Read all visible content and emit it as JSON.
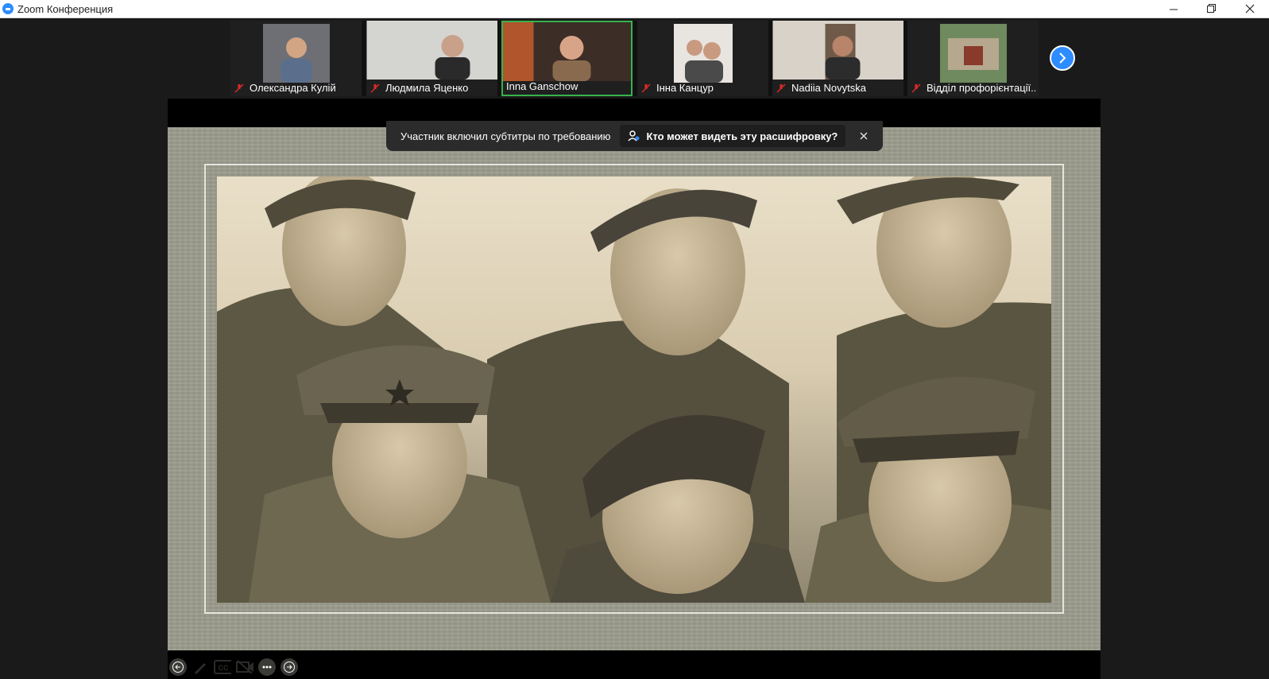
{
  "window": {
    "title": "Zoom Конференция"
  },
  "participants": [
    {
      "name": "Олександра Кулій",
      "muted": true
    },
    {
      "name": "Людмила Яценко",
      "muted": true
    },
    {
      "name": "Inna Ganschow",
      "muted": false,
      "active": true
    },
    {
      "name": "Інна Канцур",
      "muted": true
    },
    {
      "name": "Nadiia Novytska",
      "muted": true
    },
    {
      "name": "Відділ профорієнтації...",
      "muted": true
    }
  ],
  "caption_banner": {
    "text": "Участник включил субтитры по требованию",
    "link": "Кто может видеть эту расшифровку?"
  },
  "slideshow_controls": [
    "back-icon",
    "pen-icon",
    "cc-icon",
    "video-off-icon",
    "more-icon",
    "forward-icon"
  ],
  "colors": {
    "accent": "#2d8cff",
    "active_speaker": "#37b24d",
    "muted": "#e02828"
  }
}
